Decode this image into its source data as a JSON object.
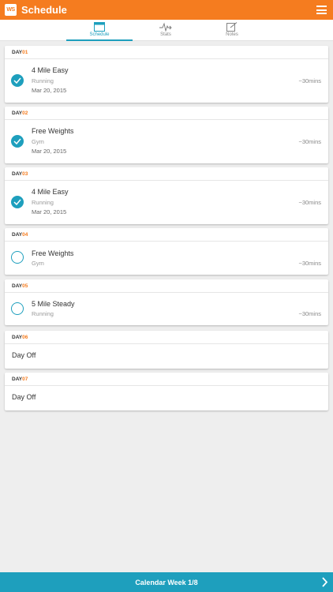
{
  "app": {
    "logo_text": "WS",
    "title": "Schedule"
  },
  "tabs": [
    {
      "label": "Schedule",
      "icon": "calendar-icon"
    },
    {
      "label": "Stats",
      "icon": "pulse-icon"
    },
    {
      "label": "Notes",
      "icon": "notes-icon"
    }
  ],
  "days": [
    {
      "prefix": "DAY",
      "num": "01",
      "title": "4 Mile Easy",
      "type": "Running",
      "date": "Mar 20, 2015",
      "duration": "~30mins",
      "done": true
    },
    {
      "prefix": "DAY",
      "num": "02",
      "title": "Free Weights",
      "type": "Gym",
      "date": "Mar 20, 2015",
      "duration": "~30mins",
      "done": true
    },
    {
      "prefix": "DAY",
      "num": "03",
      "title": "4 Mile Easy",
      "type": "Running",
      "date": "Mar 20, 2015",
      "duration": "~30mins",
      "done": true
    },
    {
      "prefix": "DAY",
      "num": "04",
      "title": "Free Weights",
      "type": "Gym",
      "duration": "~30mins",
      "done": false
    },
    {
      "prefix": "DAY",
      "num": "05",
      "title": "5 Mile Steady",
      "type": "Running",
      "duration": "~30mins",
      "done": false
    },
    {
      "prefix": "DAY",
      "num": "06",
      "dayoff": "Day Off"
    },
    {
      "prefix": "DAY",
      "num": "07",
      "dayoff": "Day Off"
    }
  ],
  "footer": {
    "label": "Calendar Week 1/8"
  },
  "colors": {
    "accent_orange": "#f57c1f",
    "accent_teal": "#1e9fbd"
  }
}
